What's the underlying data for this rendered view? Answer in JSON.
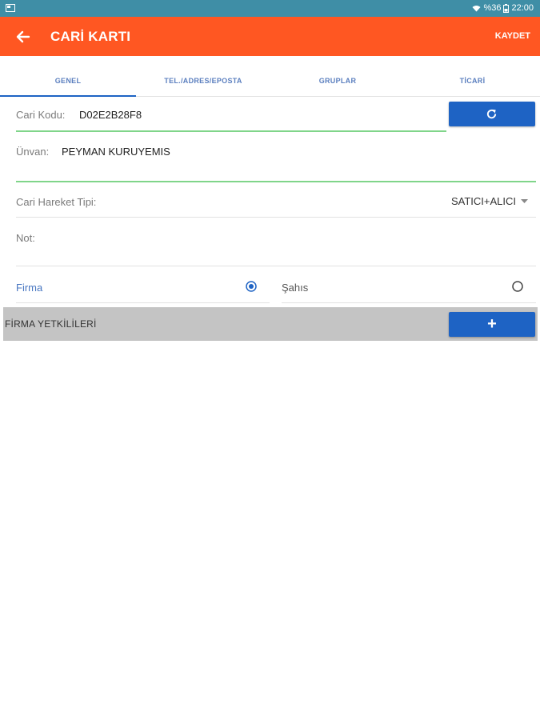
{
  "status_bar": {
    "signal_text": "%36",
    "time": "22:00",
    "icons": [
      "screenshot-icon",
      "wifi-icon",
      "battery-icon"
    ]
  },
  "app_bar": {
    "title": "CARİ KARTI",
    "save_label": "KAYDET",
    "color": "#ff5722"
  },
  "tabs": [
    {
      "label": "GENEL",
      "active": true
    },
    {
      "label": "TEL./ADRES/EPOSTA",
      "active": false
    },
    {
      "label": "GRUPLAR",
      "active": false
    },
    {
      "label": "TİCARİ",
      "active": false
    }
  ],
  "form": {
    "cari_kodu": {
      "label": "Cari Kodu:",
      "value": "D02E2B28F8"
    },
    "unvan": {
      "label": "Ünvan:",
      "value": "PEYMAN KURUYEMIS"
    },
    "hareket_tipi": {
      "label": "Cari Hareket Tipi:",
      "value": "SATICI+ALICI"
    },
    "not": {
      "label": "Not:",
      "value": ""
    },
    "type_options": [
      {
        "label": "Firma",
        "selected": true
      },
      {
        "label": "Şahıs",
        "selected": false
      }
    ]
  },
  "yetkililer": {
    "title": "FİRMA YETKİLİLERİ",
    "add_label": "+"
  },
  "colors": {
    "accent_blue": "#1e63c4",
    "valid_green": "#80d58a",
    "status_bar": "#3f8ea6"
  }
}
